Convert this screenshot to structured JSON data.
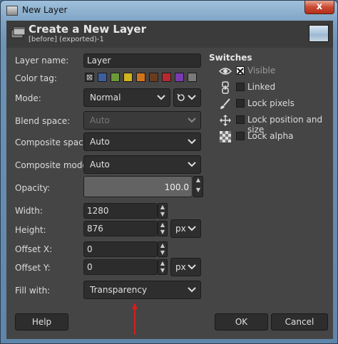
{
  "window": {
    "title": "New Layer",
    "close_glyph": "x"
  },
  "header": {
    "title": "Create a New Layer",
    "subtitle": "[before] (exported)-1"
  },
  "form": {
    "layer_name": {
      "label": "Layer name:",
      "value": "Layer"
    },
    "color_tag": {
      "label": "Color tag:",
      "selected": "none",
      "swatches": [
        "#3d5f9f",
        "#6b9a3a",
        "#d1b31f",
        "#d1731c",
        "#6a3c1f",
        "#b8282f",
        "#7a3ab0",
        "#7a7a7a"
      ]
    },
    "mode": {
      "label": "Mode:",
      "value": "Normal"
    },
    "blend_space": {
      "label": "Blend space:",
      "value": "Auto"
    },
    "composite_space": {
      "label": "Composite space:",
      "value": "Auto"
    },
    "composite_mode": {
      "label": "Composite mode:",
      "value": "Auto"
    },
    "opacity": {
      "label": "Opacity:",
      "value": "100.0"
    },
    "width": {
      "label": "Width:",
      "value": "1280"
    },
    "height": {
      "label": "Height:",
      "value": "876",
      "unit": "px"
    },
    "offset_x": {
      "label": "Offset X:",
      "value": "0"
    },
    "offset_y": {
      "label": "Offset Y:",
      "value": "0",
      "unit": "px"
    },
    "fill_with": {
      "label": "Fill with:",
      "value": "Transparency"
    }
  },
  "switches": {
    "title": "Switches",
    "items": [
      {
        "label": "Visible",
        "checked": true,
        "icon": "eye-icon"
      },
      {
        "label": "Linked",
        "checked": false,
        "icon": "chain-icon"
      },
      {
        "label": "Lock pixels",
        "checked": false,
        "icon": "brush-icon"
      },
      {
        "label": "Lock position and size",
        "checked": false,
        "icon": "move-icon"
      },
      {
        "label": "Lock alpha",
        "checked": false,
        "icon": "checkerboard-icon"
      }
    ]
  },
  "buttons": {
    "help": "Help",
    "ok": "OK",
    "cancel": "Cancel"
  },
  "colors": {
    "dialog_bg": "#454545",
    "field_bg": "#2c2c2c",
    "annotation_arrow": "#d61c1c"
  }
}
